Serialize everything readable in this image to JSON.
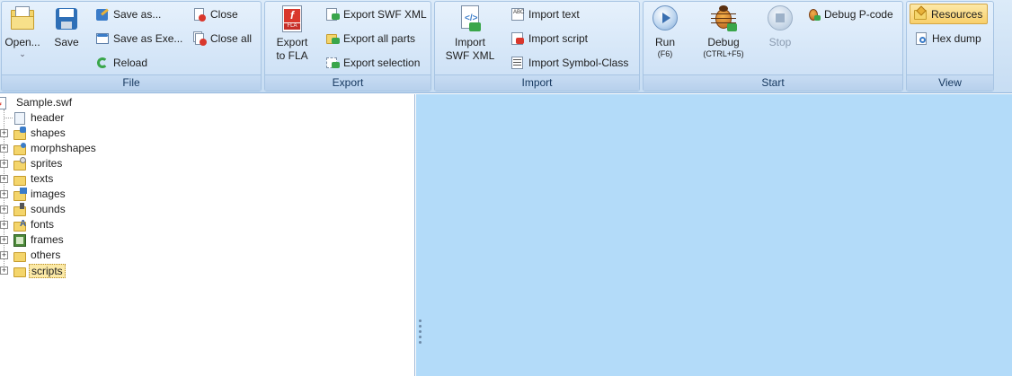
{
  "ribbon": {
    "file": {
      "label": "File",
      "open": "Open...",
      "save": "Save",
      "save_as": "Save as...",
      "save_as_exe": "Save as Exe...",
      "reload": "Reload",
      "close": "Close",
      "close_all": "Close all"
    },
    "export": {
      "label": "Export",
      "export_fla": "Export\nto FLA",
      "export_fla_l1": "Export",
      "export_fla_l2": "to FLA",
      "export_swf_xml": "Export SWF XML",
      "export_all_parts": "Export all parts",
      "export_selection": "Export selection"
    },
    "import": {
      "label": "Import",
      "import_swf_xml_l1": "Import",
      "import_swf_xml_l2": "SWF XML",
      "import_text": "Import text",
      "import_script": "Import script",
      "import_symbol_class": "Import Symbol-Class"
    },
    "start": {
      "label": "Start",
      "run": "Run",
      "run_shortcut": "(F6)",
      "debug": "Debug",
      "debug_shortcut": "(CTRL+F5)",
      "stop": "Stop",
      "debug_pcode": "Debug P-code"
    },
    "view": {
      "label": "View",
      "resources": "Resources",
      "hex_dump": "Hex dump"
    }
  },
  "tree": {
    "root": "Sample.swf",
    "items": [
      "header",
      "shapes",
      "morphshapes",
      "sprites",
      "texts",
      "images",
      "sounds",
      "fonts",
      "frames",
      "others",
      "scripts"
    ],
    "selected": "scripts"
  },
  "colors": {
    "right_pane": "#b3dbf9",
    "ribbon": "#cfe2f6",
    "selection": "#fbe9a6"
  }
}
